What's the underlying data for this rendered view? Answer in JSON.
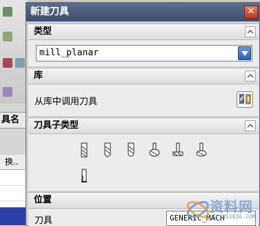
{
  "background_app": {
    "header_text": "具名",
    "column_text": "换..",
    "colors": {
      "selection": "#2c3fa8"
    }
  },
  "dialog": {
    "title": "新建刀具",
    "close_glyph": "✕",
    "sections": {
      "type": {
        "title": "类型",
        "selected_value": "mill_planar"
      },
      "library": {
        "title": "库",
        "row_label": "从库中调用刀具"
      },
      "tool_subtype": {
        "title": "刀具子类型",
        "icons": [
          "mill-tool-icon",
          "chamfer-mill-icon",
          "spherical-mill-icon",
          "t-cutter-icon",
          "barrel-cutter-icon",
          "dovetail-cutter-icon",
          "thread-mill-icon"
        ]
      },
      "location": {
        "title": "位置",
        "row_label": "刀具",
        "selected_value": "GENERIC_MACH"
      }
    }
  },
  "watermark": {
    "main": "资料网",
    "url": "ZL.XS1616.COM"
  }
}
